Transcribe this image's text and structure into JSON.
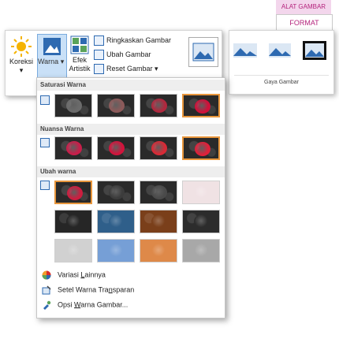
{
  "tool_tab": {
    "context_label": "ALAT GAMBAR",
    "tab_label": "FORMAT"
  },
  "ribbon": {
    "koreksi": "Koreksi",
    "warna": "Warna",
    "efek_line1": "Efek",
    "efek_line2": "Artistik",
    "compress": "Ringkaskan Gambar",
    "change": "Ubah Gambar",
    "reset": "Reset Gambar"
  },
  "gaya_label": "Gaya Gambar",
  "sections": {
    "saturation": "Saturasi Warna",
    "tone": "Nuansa Warna",
    "recolor": "Ubah warna"
  },
  "menu": {
    "more_variations_pre": "Variasi ",
    "more_variations_u": "L",
    "more_variations_post": "ainnya",
    "transparent_pre": "Setel Warna Tra",
    "transparent_u": "n",
    "transparent_post": "sparan",
    "options_pre": "Opsi ",
    "options_u": "W",
    "options_post": "arna Gambar..."
  },
  "swatch_colors": {
    "saturation": [
      "#6b6b6b",
      "#8c5a5a",
      "#b0283e",
      "#d0103a"
    ],
    "tone": [
      "#c81e4a",
      "#d2143c",
      "#d82a36",
      "#e0203a"
    ],
    "recolor_row1": [
      "#cc1d3f",
      "#3c3c3c",
      "#4a4a4a",
      "#eedde0"
    ],
    "recolor_row2": [
      "#262626",
      "#2f5f8a",
      "#7a3f1a",
      "#2c2c2c"
    ],
    "recolor_row3": [
      "#c9c9c9",
      "#5f8fcf",
      "#d9752a",
      "#9a9a9a"
    ]
  },
  "accent": "#b4237c",
  "selection": "#e8963c"
}
